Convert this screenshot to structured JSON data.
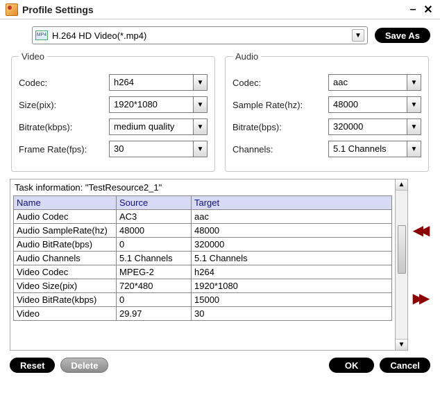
{
  "window": {
    "title": "Profile Settings"
  },
  "profile": {
    "icon_text": "MP4",
    "selected": "H.264 HD Video(*.mp4)",
    "save_as": "Save As"
  },
  "video": {
    "legend": "Video",
    "codec_label": "Codec:",
    "codec_value": "h264",
    "size_label": "Size(pix):",
    "size_value": "1920*1080",
    "bitrate_label": "Bitrate(kbps):",
    "bitrate_value": "medium quality",
    "framerate_label": "Frame Rate(fps):",
    "framerate_value": "30"
  },
  "audio": {
    "legend": "Audio",
    "codec_label": "Codec:",
    "codec_value": "aac",
    "samplerate_label": "Sample Rate(hz):",
    "samplerate_value": "48000",
    "bitrate_label": "Bitrate(bps):",
    "bitrate_value": "320000",
    "channels_label": "Channels:",
    "channels_value": "5.1 Channels"
  },
  "task": {
    "title": "Task information: \"TestResource2_1\"",
    "columns": {
      "name": "Name",
      "source": "Source",
      "target": "Target"
    },
    "rows": [
      {
        "name": "Audio Codec",
        "source": "AC3",
        "target": "aac"
      },
      {
        "name": "Audio SampleRate(hz)",
        "source": "48000",
        "target": "48000"
      },
      {
        "name": "Audio BitRate(bps)",
        "source": "0",
        "target": "320000"
      },
      {
        "name": "Audio Channels",
        "source": "5.1 Channels",
        "target": "5.1 Channels"
      },
      {
        "name": "Video Codec",
        "source": "MPEG-2",
        "target": "h264"
      },
      {
        "name": "Video Size(pix)",
        "source": "720*480",
        "target": "1920*1080"
      },
      {
        "name": "Video BitRate(kbps)",
        "source": "0",
        "target": "15000"
      },
      {
        "name": "Video",
        "source": "29.97",
        "target": "30"
      }
    ]
  },
  "buttons": {
    "reset": "Reset",
    "delete": "Delete",
    "ok": "OK",
    "cancel": "Cancel"
  }
}
